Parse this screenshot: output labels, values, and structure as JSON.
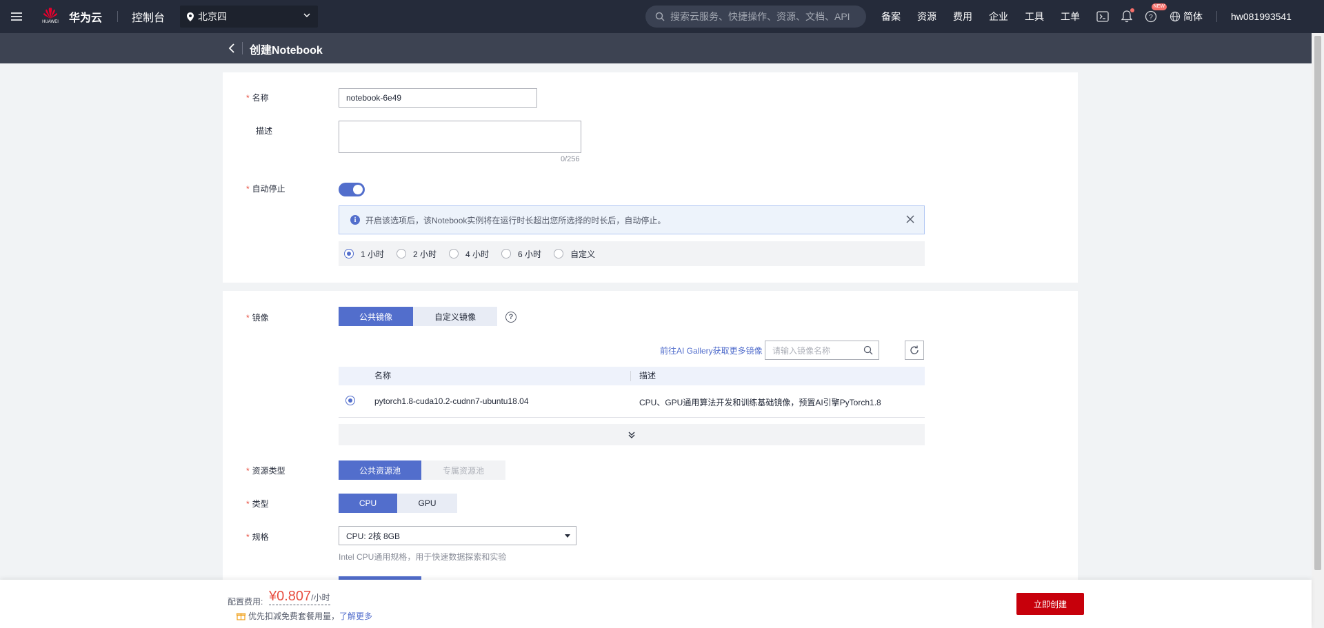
{
  "topbar": {
    "logo_sub": "HUAWEI",
    "brand": "华为云",
    "console": "控制台",
    "region": "北京四",
    "search_placeholder": "搜索云服务、快捷操作、资源、文档、API",
    "nav": [
      "备案",
      "资源",
      "费用",
      "企业",
      "工具",
      "工单"
    ],
    "new_badge": "NEW",
    "language": "简体",
    "username": "hw081993541"
  },
  "subheader": {
    "title": "创建Notebook"
  },
  "form": {
    "name_label": "名称",
    "name_value": "notebook-6e49",
    "desc_label": "描述",
    "desc_counter": "0/256",
    "autostop_label": "自动停止",
    "autostop_on": true,
    "info_text": "开启该选项后，该Notebook实例将在运行时长超出您所选择的时长后，自动停止。",
    "durations": [
      "1 小时",
      "2 小时",
      "4 小时",
      "6 小时",
      "自定义"
    ],
    "duration_selected": "1 小时"
  },
  "image": {
    "label": "镜像",
    "tab_public": "公共镜像",
    "tab_custom": "自定义镜像",
    "gallery_link": "前往AI Gallery获取更多镜像",
    "search_placeholder": "请输入镜像名称",
    "columns": [
      "名称",
      "描述"
    ],
    "rows": [
      {
        "name": "pytorch1.8-cuda10.2-cudnn7-ubuntu18.04",
        "desc": "CPU、GPU通用算法开发和训练基础镜像，预置AI引擎PyTorch1.8",
        "selected": true
      }
    ]
  },
  "resource": {
    "pool_label": "资源类型",
    "pool_public": "公共资源池",
    "pool_dedicated": "专属资源池",
    "type_label": "类型",
    "type_cpu": "CPU",
    "type_gpu": "GPU",
    "spec_label": "规格",
    "spec_value": "CPU: 2核 8GB",
    "spec_hint": "Intel CPU通用规格，用于快速数据探索和实验"
  },
  "footer": {
    "fee_label": "配置费用:",
    "price": "¥0.807",
    "unit": "/小时",
    "note": "优先扣减免费套餐用量，",
    "learn_more": "了解更多",
    "create": "立即创建"
  },
  "colors": {
    "accent": "#526ecc",
    "danger": "#c7000b",
    "nav_bg": "#252b3a"
  }
}
